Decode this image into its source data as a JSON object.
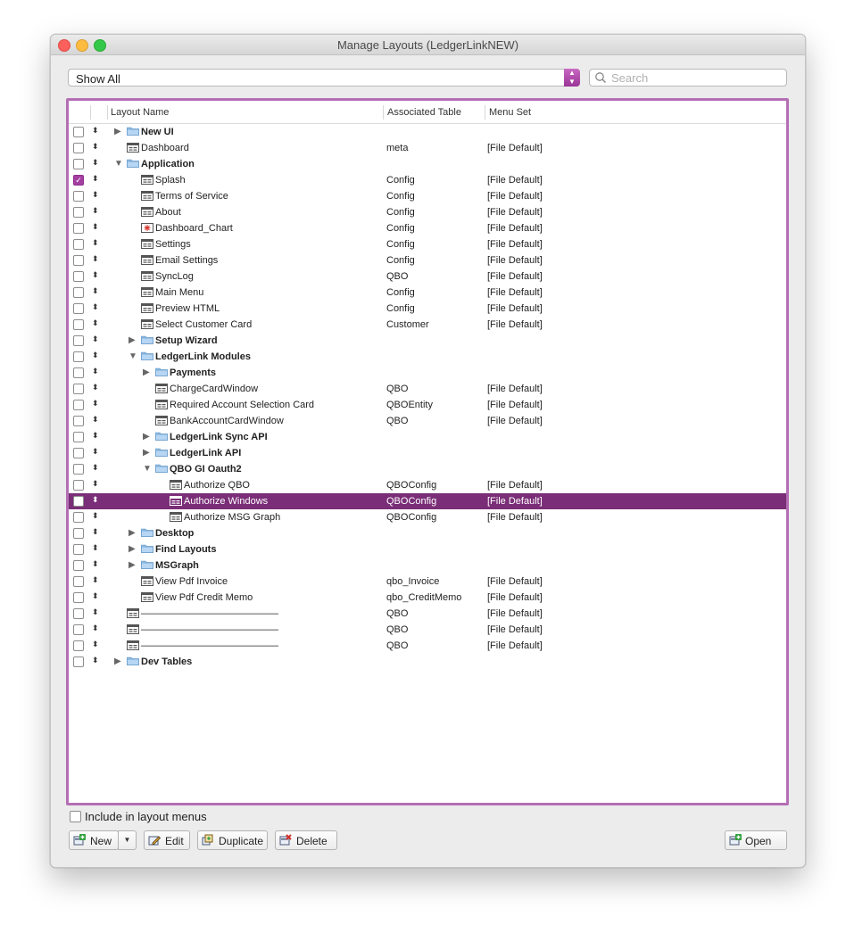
{
  "window": {
    "title": "Manage Layouts (LedgerLinkNEW)"
  },
  "filter": {
    "value": "Show All"
  },
  "search": {
    "placeholder": "Search"
  },
  "table": {
    "columns": {
      "name": "Layout Name",
      "table": "Associated Table",
      "menu": "Menu Set"
    },
    "rows": [
      {
        "name": "New UI",
        "type": "folder",
        "level": 0,
        "expanded": false,
        "table": "",
        "menu": "",
        "checked": false,
        "selected": false
      },
      {
        "name": "Dashboard",
        "type": "layout",
        "level": 0,
        "table": "meta",
        "menu": "[File Default]",
        "checked": false,
        "selected": false
      },
      {
        "name": "Application",
        "type": "folder",
        "level": 0,
        "expanded": true,
        "table": "",
        "menu": "",
        "checked": false,
        "selected": false
      },
      {
        "name": "Splash",
        "type": "layout",
        "level": 1,
        "table": "Config",
        "menu": "[File Default]",
        "checked": true,
        "selected": false
      },
      {
        "name": "Terms of Service",
        "type": "layout",
        "level": 1,
        "table": "Config",
        "menu": "[File Default]",
        "checked": false,
        "selected": false
      },
      {
        "name": "About",
        "type": "layout",
        "level": 1,
        "table": "Config",
        "menu": "[File Default]",
        "checked": false,
        "selected": false
      },
      {
        "name": "Dashboard_Chart",
        "type": "chart",
        "level": 1,
        "table": "Config",
        "menu": "[File Default]",
        "checked": false,
        "selected": false
      },
      {
        "name": "Settings",
        "type": "layout",
        "level": 1,
        "table": "Config",
        "menu": "[File Default]",
        "checked": false,
        "selected": false
      },
      {
        "name": "Email Settings",
        "type": "layout",
        "level": 1,
        "table": "Config",
        "menu": "[File Default]",
        "checked": false,
        "selected": false
      },
      {
        "name": "SyncLog",
        "type": "layout",
        "level": 1,
        "table": "QBO",
        "menu": "[File Default]",
        "checked": false,
        "selected": false
      },
      {
        "name": "Main Menu",
        "type": "layout",
        "level": 1,
        "table": "Config",
        "menu": "[File Default]",
        "checked": false,
        "selected": false
      },
      {
        "name": "Preview HTML",
        "type": "layout",
        "level": 1,
        "table": "Config",
        "menu": "[File Default]",
        "checked": false,
        "selected": false
      },
      {
        "name": "Select Customer Card",
        "type": "layout",
        "level": 1,
        "table": "Customer",
        "menu": "[File Default]",
        "checked": false,
        "selected": false
      },
      {
        "name": "Setup Wizard",
        "type": "folder",
        "level": 1,
        "expanded": false,
        "table": "",
        "menu": "",
        "checked": false,
        "selected": false
      },
      {
        "name": "LedgerLink Modules",
        "type": "folder",
        "level": 1,
        "expanded": true,
        "table": "",
        "menu": "",
        "checked": false,
        "selected": false
      },
      {
        "name": "Payments",
        "type": "folder",
        "level": 2,
        "expanded": false,
        "table": "",
        "menu": "",
        "checked": false,
        "selected": false
      },
      {
        "name": "ChargeCardWindow",
        "type": "layout",
        "level": 2,
        "table": "QBO",
        "menu": "[File Default]",
        "checked": false,
        "selected": false
      },
      {
        "name": "Required Account Selection Card",
        "type": "layout",
        "level": 2,
        "table": "QBOEntity",
        "menu": "[File Default]",
        "checked": false,
        "selected": false
      },
      {
        "name": "BankAccountCardWindow",
        "type": "layout",
        "level": 2,
        "table": "QBO",
        "menu": "[File Default]",
        "checked": false,
        "selected": false
      },
      {
        "name": "LedgerLink Sync API",
        "type": "folder",
        "level": 2,
        "expanded": false,
        "table": "",
        "menu": "",
        "checked": false,
        "selected": false
      },
      {
        "name": "LedgerLink API",
        "type": "folder",
        "level": 2,
        "expanded": false,
        "table": "",
        "menu": "",
        "checked": false,
        "selected": false
      },
      {
        "name": "QBO GI Oauth2",
        "type": "folder",
        "level": 2,
        "expanded": true,
        "table": "",
        "menu": "",
        "checked": false,
        "selected": false
      },
      {
        "name": "Authorize QBO",
        "type": "layout",
        "level": 3,
        "table": "QBOConfig",
        "menu": "[File Default]",
        "checked": false,
        "selected": false
      },
      {
        "name": "Authorize Windows",
        "type": "layout",
        "level": 3,
        "table": "QBOConfig",
        "menu": "[File Default]",
        "checked": false,
        "selected": true
      },
      {
        "name": "Authorize MSG Graph",
        "type": "layout",
        "level": 3,
        "table": "QBOConfig",
        "menu": "[File Default]",
        "checked": false,
        "selected": false
      },
      {
        "name": "Desktop",
        "type": "folder",
        "level": 1,
        "expanded": false,
        "table": "",
        "menu": "",
        "checked": false,
        "selected": false
      },
      {
        "name": "Find Layouts",
        "type": "folder",
        "level": 1,
        "expanded": false,
        "table": "",
        "menu": "",
        "checked": false,
        "selected": false
      },
      {
        "name": "MSGraph",
        "type": "folder",
        "level": 1,
        "expanded": false,
        "table": "",
        "menu": "",
        "checked": false,
        "selected": false
      },
      {
        "name": "View Pdf Invoice",
        "type": "layout",
        "level": 1,
        "table": "qbo_Invoice",
        "menu": "[File Default]",
        "checked": false,
        "selected": false
      },
      {
        "name": "View Pdf Credit Memo",
        "type": "layout",
        "level": 1,
        "table": "qbo_CreditMemo",
        "menu": "[File Default]",
        "checked": false,
        "selected": false
      },
      {
        "name": "——————————————",
        "type": "layout",
        "level": 0,
        "table": "QBO",
        "menu": "[File Default]",
        "checked": false,
        "selected": false
      },
      {
        "name": "——————————————",
        "type": "layout",
        "level": 0,
        "table": "QBO",
        "menu": "[File Default]",
        "checked": false,
        "selected": false
      },
      {
        "name": "——————————————",
        "type": "layout",
        "level": 0,
        "table": "QBO",
        "menu": "[File Default]",
        "checked": false,
        "selected": false
      },
      {
        "name": "Dev Tables",
        "type": "folder",
        "level": 0,
        "expanded": false,
        "table": "",
        "menu": "",
        "checked": false,
        "selected": false
      }
    ]
  },
  "include_label": "Include in layout menus",
  "buttons": {
    "new": "New",
    "edit": "Edit",
    "duplicate": "Duplicate",
    "delete": "Delete",
    "open": "Open"
  },
  "colors": {
    "accent": "#7a2e77",
    "table_border": "#b46fb4",
    "checkbox_checked": "#a43fa1"
  }
}
